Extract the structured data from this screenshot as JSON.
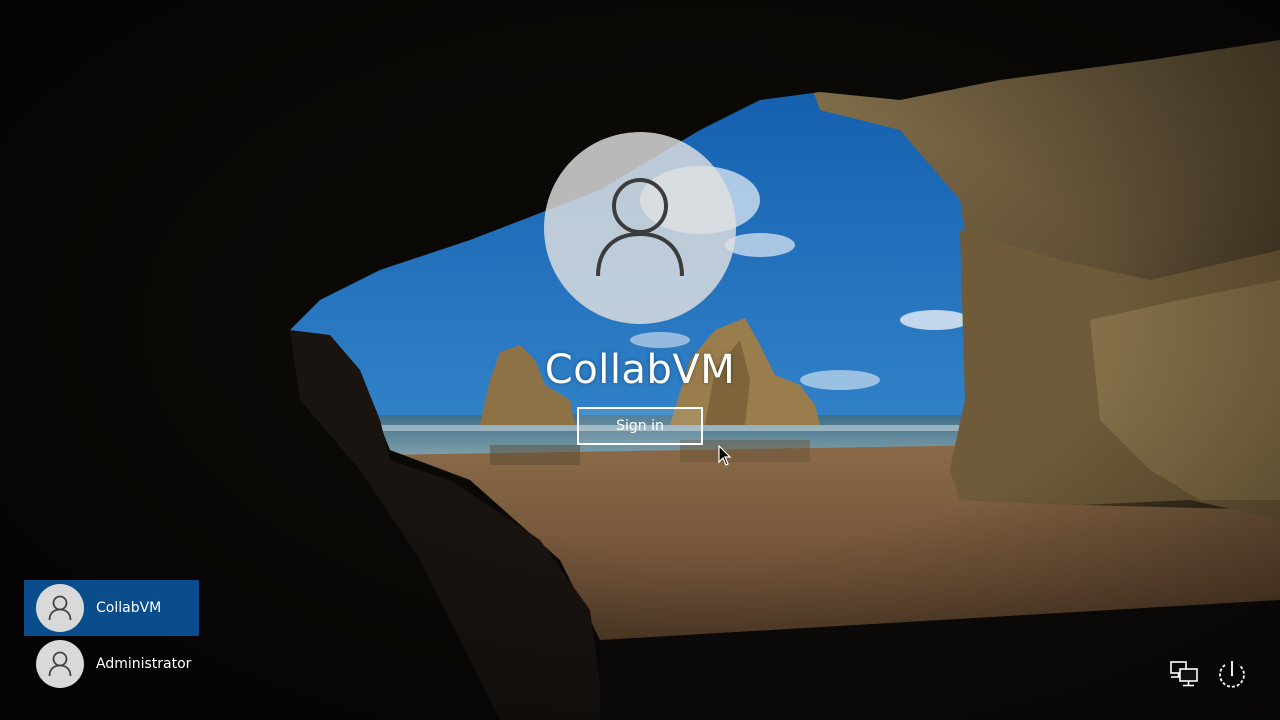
{
  "lock_screen": {
    "selected_user": "CollabVM",
    "sign_in_label": "Sign in",
    "avatar_icon": "user-icon"
  },
  "user_list": [
    {
      "name": "CollabVM",
      "selected": true,
      "icon": "user-icon"
    },
    {
      "name": "Administrator",
      "selected": false,
      "icon": "user-icon"
    }
  ],
  "corner_icons": {
    "network": "network-icon",
    "power": "power-icon"
  },
  "colors": {
    "selected_user_bg": "#0a4d8c",
    "text": "#ffffff",
    "avatar_bg": "#d9d9d9"
  }
}
